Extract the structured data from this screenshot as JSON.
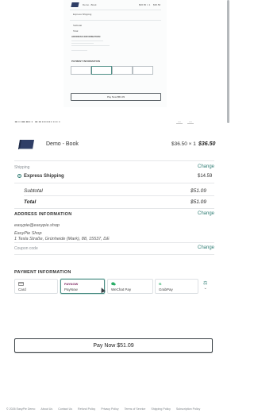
{
  "mini_preview": {
    "product_name": "Demo - Book",
    "price_text": "$36.50 × 1",
    "total_text": "$36.50",
    "shipping_option": "Express Shipping",
    "subtotal_label": "Subtotal",
    "total_label": "Total",
    "address_head": "ADDRESS INFORMATION",
    "payment_head": "PAYMENT INFORMATION",
    "pay_label": "Pay Now $51.09"
  },
  "order": {
    "section_title": "ORDER SUMMARY",
    "qty_left": "—",
    "qty_right": "—",
    "product_name": "Demo - Book",
    "unit_price": "$36.50 × 1",
    "line_total": "$36.50",
    "shipping_label": "Shipping",
    "shipping_change": "Change",
    "shipping_option": "Express Shipping",
    "shipping_price": "$14.59",
    "subtotal_label": "Subtotal",
    "subtotal_value": "$51.09",
    "total_label": "Total",
    "total_value": "$51.09"
  },
  "address": {
    "title": "ADDRESS INFORMATION",
    "change": "Change",
    "email": "easypie@easypie.shop",
    "shop": "EasyPie Shop",
    "street": "1 Tesla Straße, Grünheide (Mark), 88, 15537, DE",
    "coupon_label": "Coupon code",
    "coupon_change": "Change"
  },
  "payment": {
    "title": "PAYMENT INFORMATION",
    "methods": [
      {
        "label": "Card",
        "icon": "card-icon"
      },
      {
        "label": "PayNow",
        "icon": "paynow-icon",
        "icon_text": "PAYNOW"
      },
      {
        "label": "WeChat Pay",
        "icon": "wechat-icon"
      },
      {
        "label": "GrabPay",
        "icon": "grabpay-icon",
        "icon_text": "G"
      }
    ],
    "selected_index": 1,
    "pay_button": "Pay Now $51.09"
  },
  "footer": {
    "links": [
      "© 2026 EasyPie Demo",
      "About Us",
      "Contact Us",
      "Refund Policy",
      "Privacy Policy",
      "Terms of Service",
      "Shipping Policy",
      "Subscription Policy"
    ]
  },
  "colors": {
    "accent": "#2f7d74",
    "text": "#2a2f33",
    "border": "#dde1e4"
  }
}
